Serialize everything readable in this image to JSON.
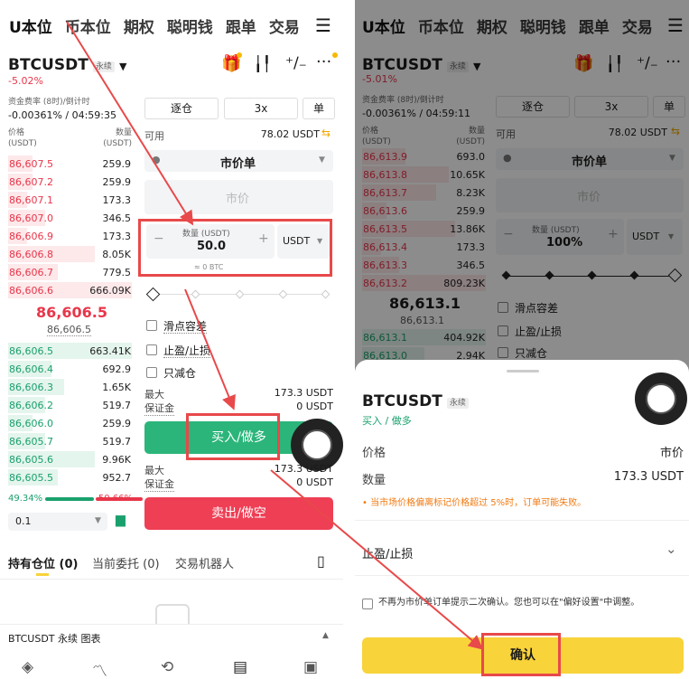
{
  "tabs": [
    "U本位",
    "币本位",
    "期权",
    "聪明钱",
    "跟单",
    "交易"
  ],
  "left": {
    "pair": "BTCUSDT",
    "contract_type": "永续",
    "change": "-5.02%",
    "funding_label": "资金费率 (8时)/倒计时",
    "funding_value": "-0.00361% / 04:59:35",
    "price_header": "价格",
    "price_unit": "(USDT)",
    "qty_header": "数量",
    "qty_unit": "(USDT)",
    "asks": [
      {
        "price": "86,607.5",
        "qty": "259.9",
        "depth": 0.2
      },
      {
        "price": "86,607.2",
        "qty": "259.9",
        "depth": 0.2
      },
      {
        "price": "86,607.1",
        "qty": "173.3",
        "depth": 0.15
      },
      {
        "price": "86,607.0",
        "qty": "346.5",
        "depth": 0.3
      },
      {
        "price": "86,606.9",
        "qty": "173.3",
        "depth": 0.15
      },
      {
        "price": "86,606.8",
        "qty": "8.05K",
        "depth": 0.7
      },
      {
        "price": "86,606.7",
        "qty": "779.5",
        "depth": 0.4
      },
      {
        "price": "86,606.6",
        "qty": "666.09K",
        "depth": 1.0
      }
    ],
    "mid_price": "86,606.5",
    "mark_price": "86,606.5",
    "bids": [
      {
        "price": "86,606.5",
        "qty": "663.41K",
        "depth": 1.0
      },
      {
        "price": "86,606.4",
        "qty": "692.9",
        "depth": 0.35
      },
      {
        "price": "86,606.3",
        "qty": "1.65K",
        "depth": 0.45
      },
      {
        "price": "86,606.2",
        "qty": "519.7",
        "depth": 0.3
      },
      {
        "price": "86,606.0",
        "qty": "259.9",
        "depth": 0.2
      },
      {
        "price": "86,605.7",
        "qty": "519.7",
        "depth": 0.3
      },
      {
        "price": "86,605.6",
        "qty": "9.96K",
        "depth": 0.7
      },
      {
        "price": "86,605.5",
        "qty": "952.7",
        "depth": 0.4
      }
    ],
    "buy_ratio": "49.34%",
    "sell_ratio": "50.66%",
    "buy_fraction": 0.4934,
    "precision": "0.1",
    "margin_mode": "逐仓",
    "leverage": "3x",
    "position_mode": "单",
    "available_label": "可用",
    "available_value": "78.02 USDT",
    "order_type": "市价单",
    "price_placeholder": "市价",
    "qty_label": "数量 (USDT)",
    "qty_value": "50.0",
    "qty_currency": "USDT",
    "qty_btc": "≈ 0 BTC",
    "slippage": "滑点容差",
    "tpsl": "止盈/止损",
    "reduce_only": "只减仓",
    "max_label": "最大",
    "max_value_buy": "173.3 USDT",
    "margin_label": "保证金",
    "margin_value_buy": "0 USDT",
    "buy_button": "买入/做多",
    "max_value_sell": "173.3 USDT",
    "margin_value_sell": "0 USDT",
    "sell_button": "卖出/做空",
    "bottom_tabs": [
      "持有仓位 (0)",
      "当前委托 (0)",
      "交易机器人"
    ],
    "footer_label": "BTCUSDT 永续  图表"
  },
  "right": {
    "pair": "BTCUSDT",
    "contract_type": "永续",
    "change": "-5.01%",
    "funding_label": "资金费率 (8时)/倒计时",
    "funding_value": "-0.00361% / 04:59:11",
    "price_header": "价格",
    "price_unit": "(USDT)",
    "qty_header": "数量",
    "qty_unit": "(USDT)",
    "asks": [
      {
        "price": "86,613.9",
        "qty": "693.0",
        "depth": 0.35
      },
      {
        "price": "86,613.8",
        "qty": "10.65K",
        "depth": 0.7
      },
      {
        "price": "86,613.7",
        "qty": "8.23K",
        "depth": 0.6
      },
      {
        "price": "86,613.6",
        "qty": "259.9",
        "depth": 0.2
      },
      {
        "price": "86,613.5",
        "qty": "13.86K",
        "depth": 0.75
      },
      {
        "price": "86,613.4",
        "qty": "173.3",
        "depth": 0.15
      },
      {
        "price": "86,613.3",
        "qty": "346.5",
        "depth": 0.3
      },
      {
        "price": "86,613.2",
        "qty": "809.23K",
        "depth": 1.0
      }
    ],
    "mid_price": "86,613.1",
    "mark_price": "86,613.1",
    "bids": [
      {
        "price": "86,613.1",
        "qty": "404.92K",
        "depth": 1.0
      },
      {
        "price": "86,613.0",
        "qty": "2.94K",
        "depth": 0.5
      }
    ],
    "margin_mode": "逐仓",
    "leverage": "3x",
    "position_mode": "单",
    "available_label": "可用",
    "available_value": "78.02 USDT",
    "order_type": "市价单",
    "price_placeholder": "市价",
    "qty_label": "数量 (USDT)",
    "qty_value": "100%",
    "qty_currency": "USDT",
    "slippage": "滑点容差",
    "tpsl": "止盈/止损",
    "reduce_only": "只减仓",
    "sheet": {
      "pair": "BTCUSDT",
      "contract_type": "永续",
      "direction": "买入 / 做多",
      "price_label": "价格",
      "price_value": "市价",
      "qty_label": "数量",
      "qty_value": "173.3 USDT",
      "warning": "• 当市场价格偏离标记价格超过 5%时，订单可能失败。",
      "tpsl_label": "止盈/止损",
      "no_confirm_text": "不再为市价单订单提示二次确认。您也可以在\"偏好设置\"中调整。",
      "confirm_button": "确认"
    }
  },
  "colors": {
    "red": "#e8364a",
    "green": "#1aa06d",
    "yellow": "#f8d33a",
    "annotation": "#e8494a"
  }
}
